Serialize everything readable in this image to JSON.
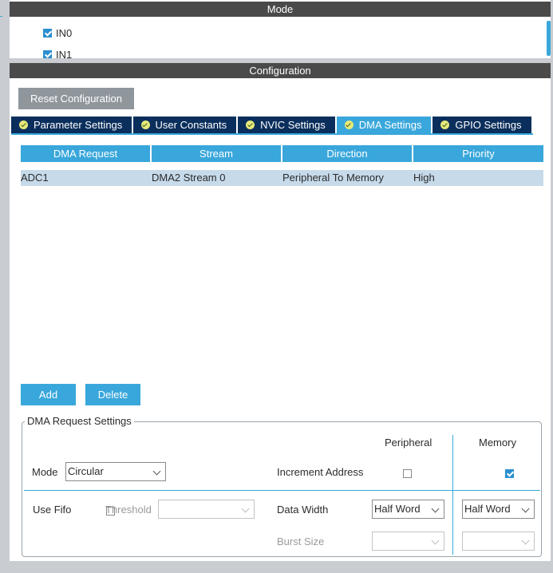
{
  "mode_panel": {
    "title": "Mode",
    "items": [
      {
        "label": "IN0",
        "checked": true
      },
      {
        "label": "IN1",
        "checked": true
      }
    ]
  },
  "config_panel": {
    "title": "Configuration",
    "reset_button": "Reset Configuration",
    "tabs": [
      {
        "label": "Parameter Settings",
        "active": false
      },
      {
        "label": "User Constants",
        "active": false
      },
      {
        "label": "NVIC Settings",
        "active": false
      },
      {
        "label": "DMA Settings",
        "active": true
      },
      {
        "label": "GPIO Settings",
        "active": false
      }
    ]
  },
  "dma_table": {
    "headers": [
      "DMA Request",
      "Stream",
      "Direction",
      "Priority"
    ],
    "rows": [
      [
        "ADC1",
        "DMA2 Stream 0",
        "Peripheral To Memory",
        "High"
      ]
    ]
  },
  "buttons": {
    "add": "Add",
    "delete": "Delete"
  },
  "request_settings": {
    "title": "DMA Request Settings",
    "peripheral_header": "Peripheral",
    "memory_header": "Memory",
    "mode_label": "Mode",
    "mode_value": "Circular",
    "increment_label": "Increment Address",
    "increment_peripheral": false,
    "increment_memory": true,
    "use_fifo_label": "Use Fifo",
    "use_fifo": false,
    "threshold_label": "Threshold",
    "threshold_value": "",
    "data_width_label": "Data Width",
    "data_width_peripheral": "Half Word",
    "data_width_memory": "Half Word",
    "burst_size_label": "Burst Size",
    "burst_peripheral": "",
    "burst_memory": ""
  },
  "colors": {
    "accent": "#39a7db",
    "tab_dark": "#0b2f5c",
    "row_selected": "#c6daea",
    "header_bar": "#4a4a4a"
  }
}
